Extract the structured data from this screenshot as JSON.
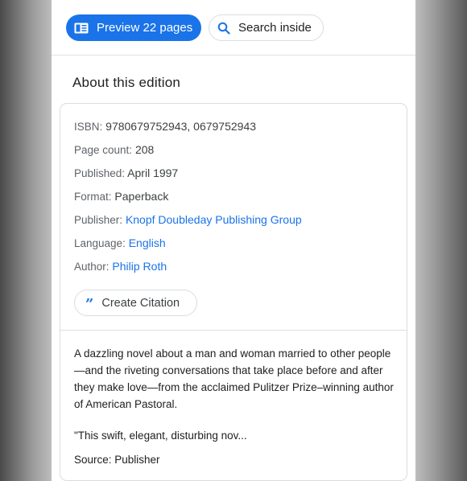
{
  "toolbar": {
    "preview_label": "Preview 22 pages",
    "search_label": "Search inside"
  },
  "edition": {
    "title": "About this edition",
    "fields": [
      {
        "label": "ISBN:",
        "value": "9780679752943, 0679752943",
        "link": false
      },
      {
        "label": "Page count:",
        "value": "208",
        "link": false
      },
      {
        "label": "Published:",
        "value": "April 1997",
        "link": false
      },
      {
        "label": "Format:",
        "value": "Paperback",
        "link": false
      },
      {
        "label": "Publisher:",
        "value": "Knopf Doubleday Publishing Group",
        "link": true
      },
      {
        "label": "Language:",
        "value": "English",
        "link": true
      },
      {
        "label": "Author:",
        "value": "Philip Roth",
        "link": true
      }
    ],
    "cite_label": "Create Citation"
  },
  "description": {
    "text": "A dazzling novel about a man and woman married to other people—and the riveting conversations that take place before and after they make love—from the acclaimed Pulitzer Prize–winning author of American Pastoral.",
    "quote": "\"This swift, elegant, disturbing nov...",
    "source": "Source: Publisher"
  },
  "colors": {
    "accent": "#1a73e8",
    "text": "#202124",
    "muted": "#5f6368",
    "border": "#dadce0"
  },
  "icons": {
    "preview": "book-preview-icon",
    "search": "search-icon",
    "cite": "quote-icon"
  }
}
